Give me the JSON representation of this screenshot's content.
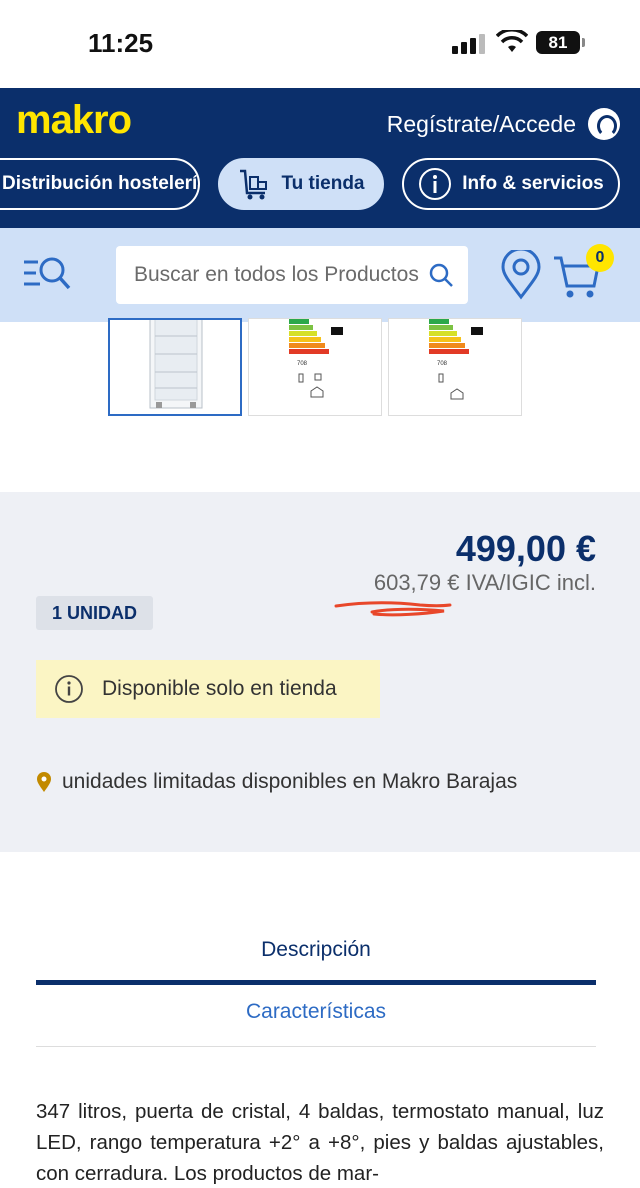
{
  "status_bar": {
    "time": "11:25",
    "battery": "81"
  },
  "header": {
    "logo": "makro",
    "account_label": "Regístrate/Accede",
    "nav": [
      {
        "label": "Distribución hostelería"
      },
      {
        "label": "Tu tienda"
      },
      {
        "label": "Info & servicios"
      }
    ]
  },
  "search": {
    "placeholder": "Buscar en todos los Productos",
    "cart_count": "0"
  },
  "gallery": {
    "thumbnails": [
      {
        "name": "refrigerator-photo"
      },
      {
        "name": "energy-label-d"
      },
      {
        "name": "energy-label-alt"
      }
    ],
    "energy_value": "708"
  },
  "price": {
    "main": "499,00 €",
    "vat": "603,79 € IVA/IGIC incl.",
    "unit": "1 UNIDAD",
    "notice": "Disponible solo en tienda",
    "stock": "unidades limitadas disponibles en Makro Barajas",
    "colors": {
      "brand": "#0b2f6b",
      "accent": "#ffe500",
      "notice_bg": "#fbf5c4",
      "stock_pin": "#c28a00",
      "scribble": "#e8472a"
    }
  },
  "tabs": {
    "description": "Descripción",
    "features": "Características",
    "text": "347 litros, puerta de cristal, 4 baldas, termostato manual, luz LED, rango temperatura +2° a +8°, pies y baldas ajustables, con cerradura. Los productos de mar-"
  }
}
